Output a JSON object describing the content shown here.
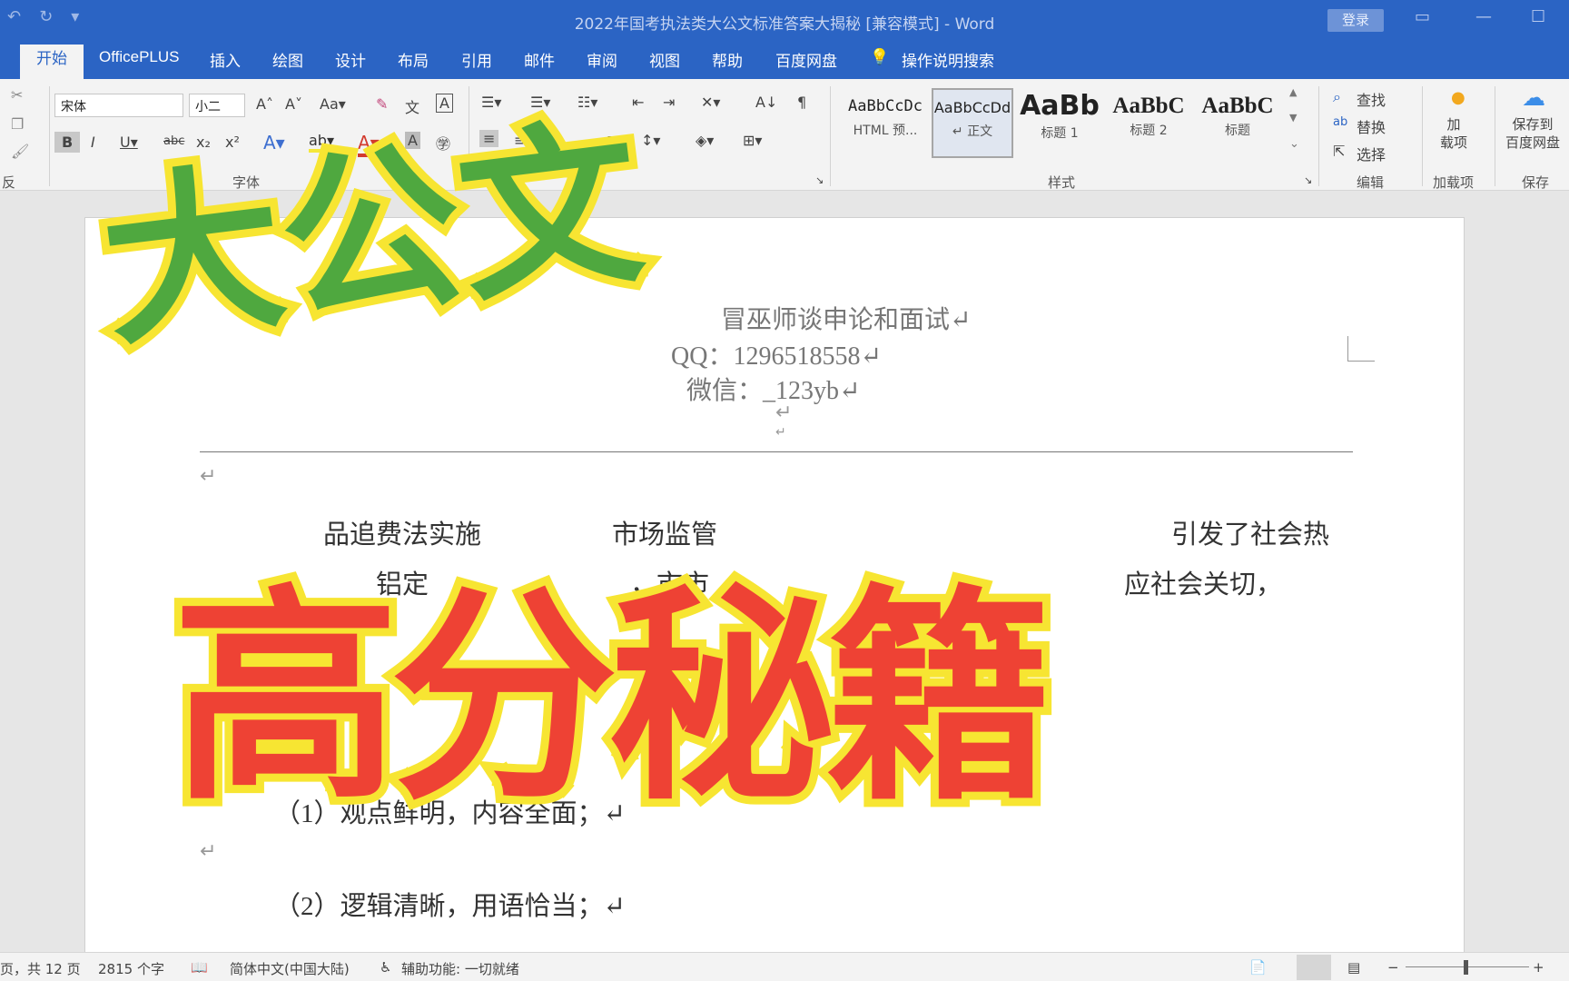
{
  "titlebar": {
    "document_title": "2022年国考执法类大公文标准答案大揭秘 [兼容模式] - Word",
    "login_label": "登录"
  },
  "tabs": [
    "开始",
    "OfficePLUS",
    "插入",
    "绘图",
    "设计",
    "布局",
    "引用",
    "邮件",
    "审阅",
    "视图",
    "帮助",
    "百度网盘",
    "操作说明搜索"
  ],
  "ribbon": {
    "font_name": "宋体",
    "font_size": "小二",
    "group_font": "字体",
    "group_styles": "样式",
    "group_edit": "编辑",
    "group_addins": "加载项",
    "group_save": "保存",
    "clipboard_partial": "反",
    "styles": [
      {
        "sample": "AaBbCcDc",
        "name": "HTML 预..."
      },
      {
        "sample": "AaBbCcDd",
        "name": "↵ 正文"
      },
      {
        "sample": "AaBb",
        "name": "标题 1"
      },
      {
        "sample": "AaBbC",
        "name": "标题 2"
      },
      {
        "sample": "AaBbC",
        "name": "标题"
      }
    ],
    "find": "查找",
    "replace": "替换",
    "select": "选择",
    "addin_label": "加\n载项",
    "save_to_baidu": "保存到\n百度网盘"
  },
  "document": {
    "header_line1": "冒巫师谈申论和面试↵",
    "header_line2": "QQ：1296518558↵",
    "header_line3": "微信：_123yb↵",
    "para_line1_left": "品追费法实施",
    "para_line1_mid": "市场监管",
    "para_line1_right": "引发了社会热",
    "para_line2_left": "铝定",
    "para_line2_mid": "，市市",
    "para_line2_right": "应社会关切，",
    "item1": "（1）观点鲜明，内容全面；↵",
    "item2": "（2）逻辑清晰，用语恰当；↵",
    "return_mark": "↵"
  },
  "overlay": {
    "title_green": "大公文",
    "title_red": "高分秘籍"
  },
  "status": {
    "pages": "页，共 12 页",
    "words": "2815 个字",
    "language": "简体中文(中国大陆)",
    "accessibility": "辅助功能: 一切就绪",
    "zoom_minus": "−",
    "zoom_plus": "+"
  },
  "colors": {
    "brand_blue": "#2b64c4",
    "overlay_green": "#4fa83f",
    "overlay_red": "#ee4234",
    "overlay_outline": "#f7e532"
  }
}
